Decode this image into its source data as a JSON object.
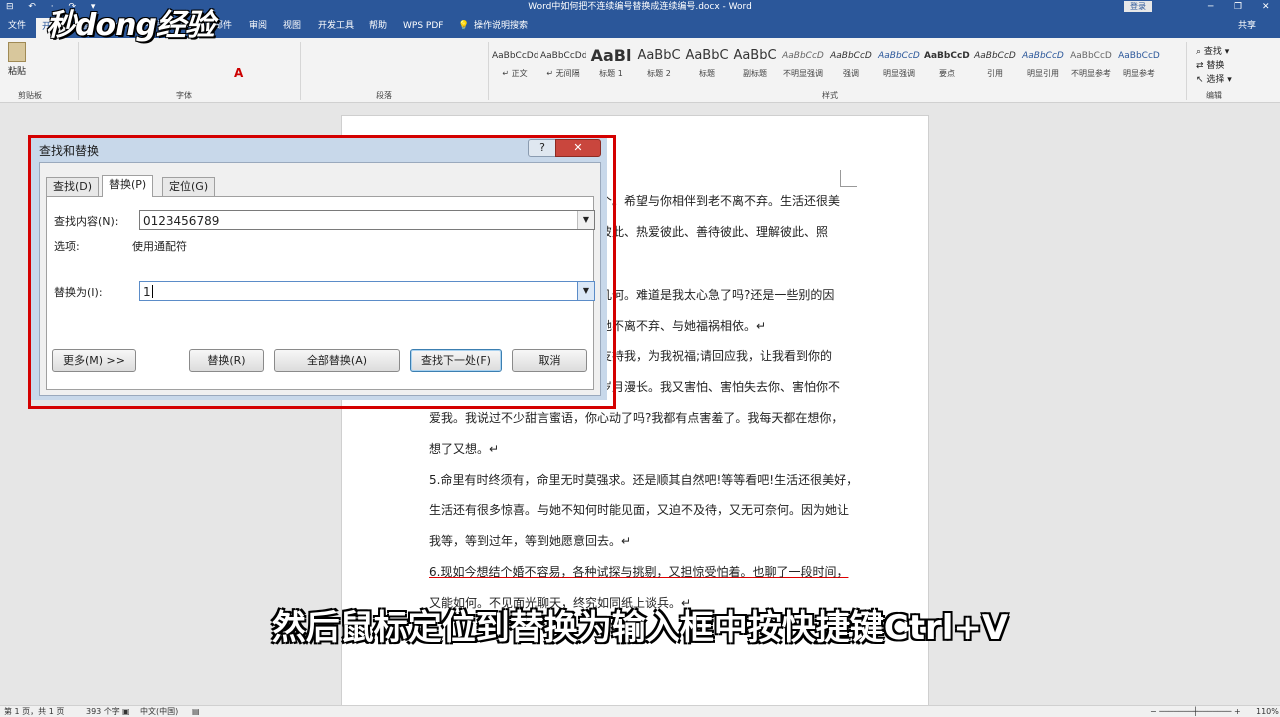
{
  "window": {
    "title": "Word中如何把不连续编号替换成连续编号.docx - Word",
    "quick_access": "⊟ ↶ · ↷ ▾",
    "login": "登录",
    "controls": [
      "─",
      "❐",
      "✕"
    ]
  },
  "ribbon_tabs": [
    "文件",
    "开始",
    "插入",
    "设计",
    "布局",
    "引用",
    "邮件",
    "审阅",
    "视图",
    "开发工具",
    "帮助",
    "WPS PDF",
    "操作说明搜索"
  ],
  "ribbon_right": "共享",
  "ribbon": {
    "paste": "粘贴",
    "clipboard_group": "剪贴板",
    "font_group": "字体",
    "paragraph_group": "段落",
    "styles_group": "样式",
    "editing_group": "编辑",
    "font_color_glyph": "A",
    "styles": [
      {
        "sample": "AaBbCcDd",
        "name": "↵ 正文"
      },
      {
        "sample": "AaBbCcDd",
        "name": "↵ 无间隔"
      },
      {
        "sample": "AaBl",
        "name": "标题 1"
      },
      {
        "sample": "AaBbC",
        "name": "标题 2"
      },
      {
        "sample": "AaBbC",
        "name": "标题"
      },
      {
        "sample": "AaBbC",
        "name": "副标题"
      },
      {
        "sample": "AaBbCcD",
        "name": "不明显强调"
      },
      {
        "sample": "AaBbCcD",
        "name": "强调"
      },
      {
        "sample": "AaBbCcD",
        "name": "明显强调"
      },
      {
        "sample": "AaBbCcDd",
        "name": "要点"
      },
      {
        "sample": "AaBbCcD",
        "name": "引用"
      },
      {
        "sample": "AaBbCcD",
        "name": "明显引用"
      },
      {
        "sample": "AaBbCcD",
        "name": "不明显参考"
      },
      {
        "sample": "AaBbCcD",
        "name": "明显参考"
      }
    ],
    "editing": [
      "查找 ▾",
      "替换",
      "选择 ▾"
    ]
  },
  "watermark": "秒dong经验",
  "document_lines": [
    "个。希望与你相伴到老不离不弃。生活还很美",
    "彼此、热爱彼此、善待彼此、理解彼此、照",
    "几何。难道是我太心急了吗?还是一些别的因",
    "她不离不弃、与她福祸相依。↵",
    "支持我，为我祝福;请回应我，让我看到你的",
    "岁月漫长。我又害怕、害怕失去你、害怕你不",
    "爱我。我说过不少甜言蜜语，你心动了吗?我都有点害羞了。我每天都在想你，",
    "想了又想。↵",
    "5.命里有时终须有，命里无时莫强求。还是顺其自然吧!等等看吧!生活还很美好，",
    "生活还有很多惊喜。与她不知何时能见面，又迫不及待，又无可奈何。因为她让",
    "我等，等到过年，等到她愿意回去。↵",
    "6.现如今想结个婚不容易，各种试探与挑剔，又担惊受怕着。也聊了一段时间，",
    "又能如何。不见面光聊天，终究如同纸上谈兵。↵"
  ],
  "dialog": {
    "title": "查找和替换",
    "help": "?",
    "close": "✕",
    "tabs": [
      "查找(D)",
      "替换(P)",
      "定位(G)"
    ],
    "find_label": "查找内容(N):",
    "find_value": "0123456789",
    "options_label": "选项:",
    "options_value": "使用通配符",
    "replace_label": "替换为(I):",
    "replace_value": "1",
    "dropdown_glyph": "▼",
    "buttons": {
      "more": "更多(M) >>",
      "replace": "替换(R)",
      "replace_all": "全部替换(A)",
      "find_next": "查找下一处(F)",
      "cancel": "取消"
    }
  },
  "subtitle": "然后鼠标定位到替换为输入框中按快捷键Ctrl+V",
  "status": {
    "page": "第 1 页，共 1 页",
    "words": "393 个字",
    "language": "中文(中国)",
    "zoom": "110%"
  }
}
